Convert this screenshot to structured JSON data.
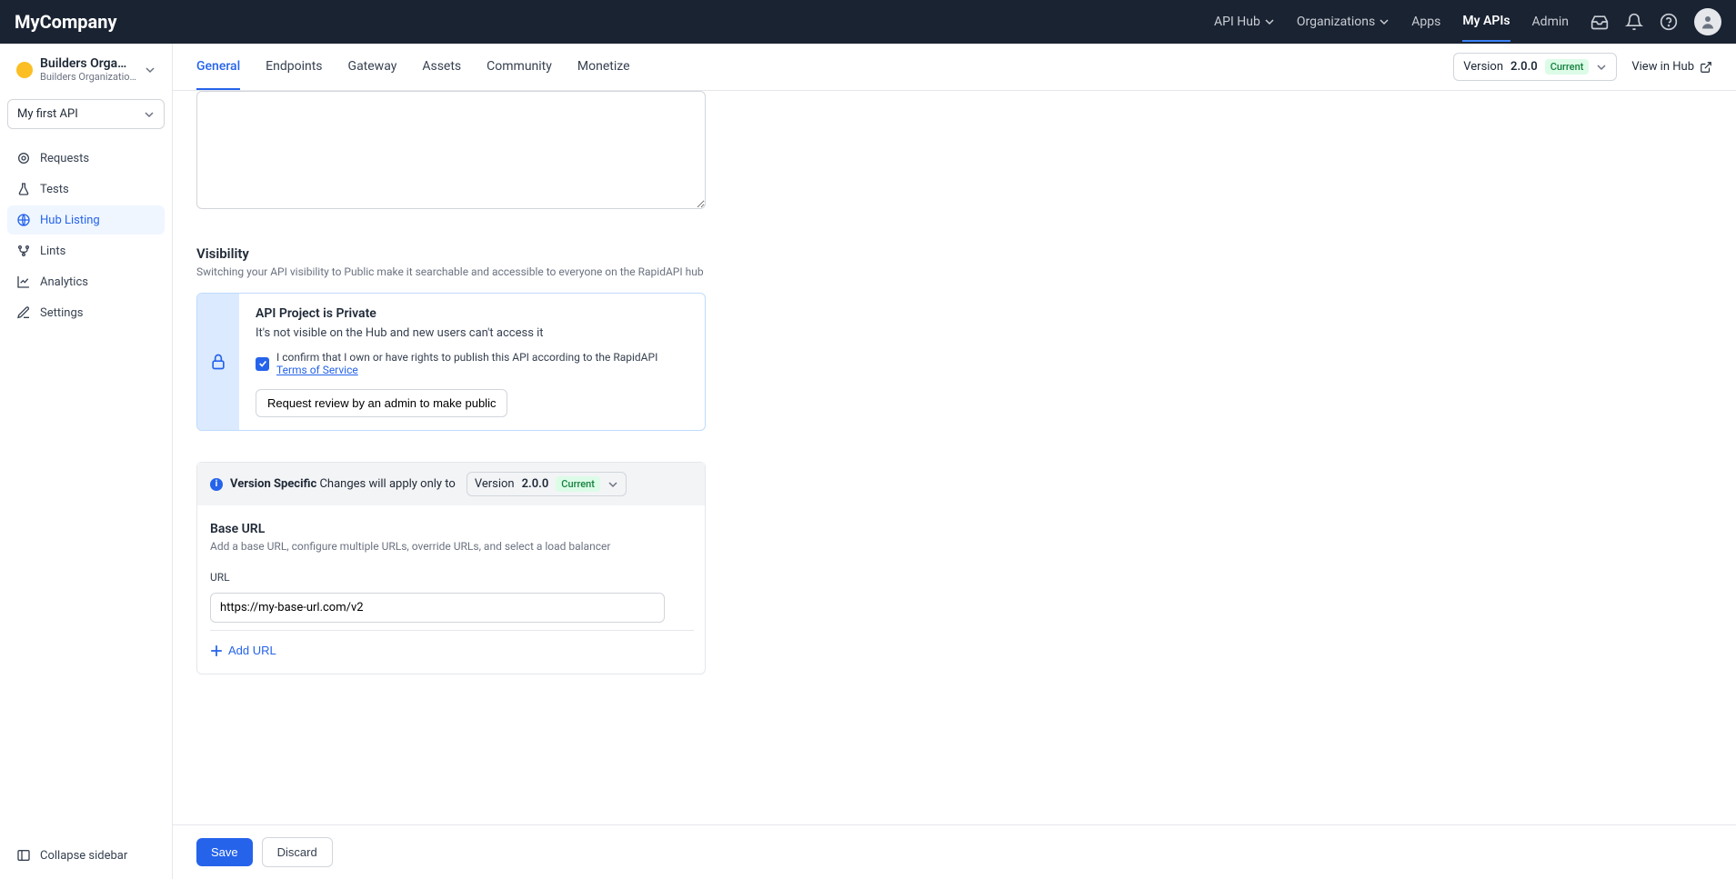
{
  "header": {
    "brand": "MyCompany",
    "nav": {
      "api_hub": "API Hub",
      "organizations": "Organizations",
      "apps": "Apps",
      "my_apis": "My APIs",
      "admin": "Admin"
    }
  },
  "sidebar": {
    "org": {
      "name": "Builders Orga…",
      "sub": "Builders Organization-D…"
    },
    "api_select": "My first API",
    "items": {
      "requests": "Requests",
      "tests": "Tests",
      "hub_listing": "Hub Listing",
      "lints": "Lints",
      "analytics": "Analytics",
      "settings": "Settings"
    },
    "collapse": "Collapse sidebar"
  },
  "tabs": {
    "general": "General",
    "endpoints": "Endpoints",
    "gateway": "Gateway",
    "assets": "Assets",
    "community": "Community",
    "monetize": "Monetize"
  },
  "tabbar_right": {
    "version_label": "Version",
    "version_num": "2.0.0",
    "current": "Current",
    "view_in_hub": "View in Hub"
  },
  "visibility": {
    "title": "Visibility",
    "subtitle": "Switching your API visibility to Public make it searchable and accessible to everyone on the RapidAPI hub",
    "box_title": "API Project is Private",
    "box_sub": "It's not visible on the Hub and new users can't access it",
    "confirm_prefix": "I confirm that I own or have rights to publish this API according to the RapidAPI ",
    "tos": "Terms of Service",
    "request_btn": "Request review by an admin to make public"
  },
  "version_specific": {
    "label_bold": "Version Specific",
    "label_rest": "Changes will apply only to",
    "dd_version_label": "Version",
    "dd_version_num": "2.0.0",
    "dd_current": "Current"
  },
  "baseurl": {
    "title": "Base URL",
    "sub": "Add a base URL, configure multiple URLs, override URLs, and select a load balancer",
    "url_label": "URL",
    "url_value": "https://my-base-url.com/v2",
    "add_url": "Add URL"
  },
  "footer": {
    "save": "Save",
    "discard": "Discard"
  }
}
